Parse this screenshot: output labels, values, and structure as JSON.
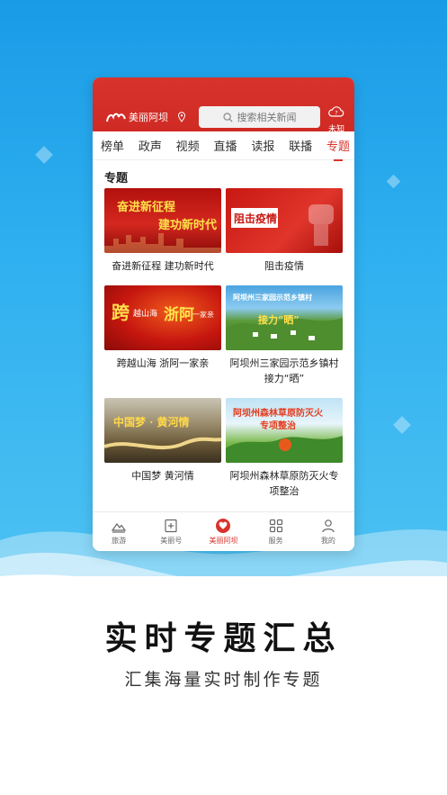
{
  "app": {
    "name": "美丽阿坝",
    "search_placeholder": "搜索相关新闻",
    "weather_label": "未知"
  },
  "tabs": [
    "榜单",
    "政声",
    "视频",
    "直播",
    "读报",
    "联播",
    "专题"
  ],
  "active_tab": "专题",
  "section_title": "专题",
  "cards": [
    {
      "caption": "奋进新征程 建功新时代",
      "image_text_1": "奋进新征程",
      "image_text_2": "建功新时代"
    },
    {
      "caption": "阻击疫情",
      "image_text_1": "阻击疫情"
    },
    {
      "caption": "跨越山海 浙阿一家亲",
      "image_text_1": "跨",
      "image_text_2": "越山海",
      "image_text_3": "浙阿",
      "image_text_4": "一家亲"
    },
    {
      "caption": "阿坝州三家园示范乡镇村接力“晒”",
      "image_text_1": "阿坝州三家园示范乡镇村",
      "image_text_2": "接力“晒”"
    },
    {
      "caption": "中国梦 黄河情",
      "image_text_1": "中国梦 · 黄河情"
    },
    {
      "caption": "阿坝州森林草原防灭火专项整治",
      "image_text_1": "阿坝州森林草原防灭火",
      "image_text_2": "专项整治"
    }
  ],
  "bottom_nav": [
    {
      "label": "旅游",
      "icon": "mountain-icon"
    },
    {
      "label": "美丽号",
      "icon": "plus-bookmark-icon"
    },
    {
      "label": "美丽阿坝",
      "icon": "heart-icon"
    },
    {
      "label": "服务",
      "icon": "grid-icon"
    },
    {
      "label": "我的",
      "icon": "user-icon"
    }
  ],
  "promo": {
    "headline": "实时专题汇总",
    "subline": "汇集海量实时制作专题"
  },
  "colors": {
    "brand_red": "#d8332c",
    "background_blue": "#2fb0f0"
  }
}
